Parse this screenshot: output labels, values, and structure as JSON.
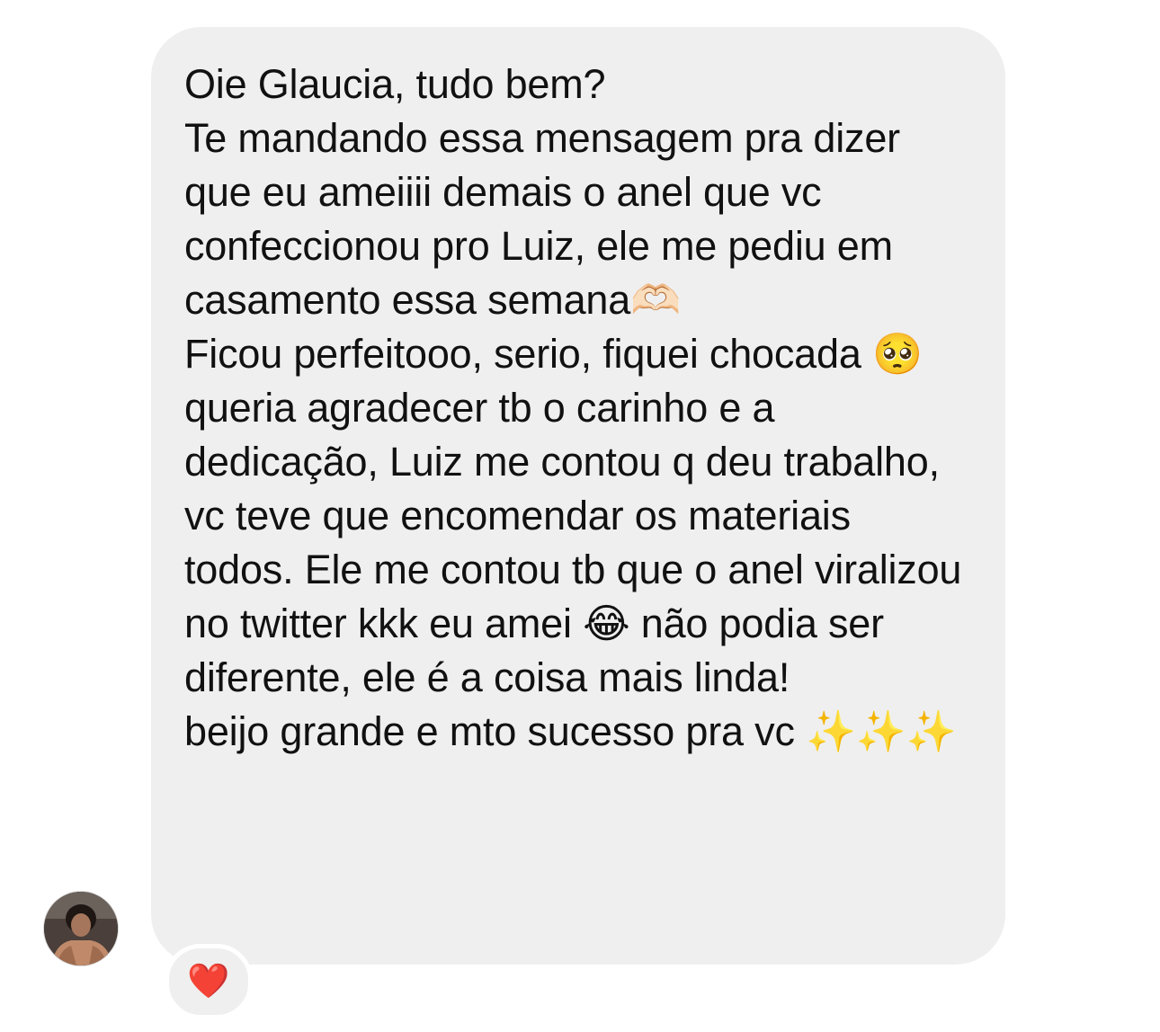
{
  "message": {
    "text": "Oie Glaucia, tudo bem?\nTe mandando essa mensagem pra dizer que eu ameiiii demais o anel que vc confeccionou pro Luiz, ele me pediu em casamento essa semana🫶🏻\nFicou perfeitooo, serio, fiquei chocada 🥺\nqueria agradecer tb o carinho e a dedicação, Luiz me contou q deu trabalho, vc teve que encomendar os materiais todos. Ele me contou tb que o anel viralizou no twitter kkk eu amei 😂 não podia ser diferente, ele é a coisa mais linda!\nbeijo grande e mto sucesso pra vc ✨✨✨"
  },
  "reaction": {
    "emoji": "❤️"
  },
  "sender": {
    "avatar_icon": "profile-photo-icon"
  },
  "colors": {
    "bubble_background": "#efefef",
    "text": "#111111",
    "heart": "#e0202e"
  }
}
